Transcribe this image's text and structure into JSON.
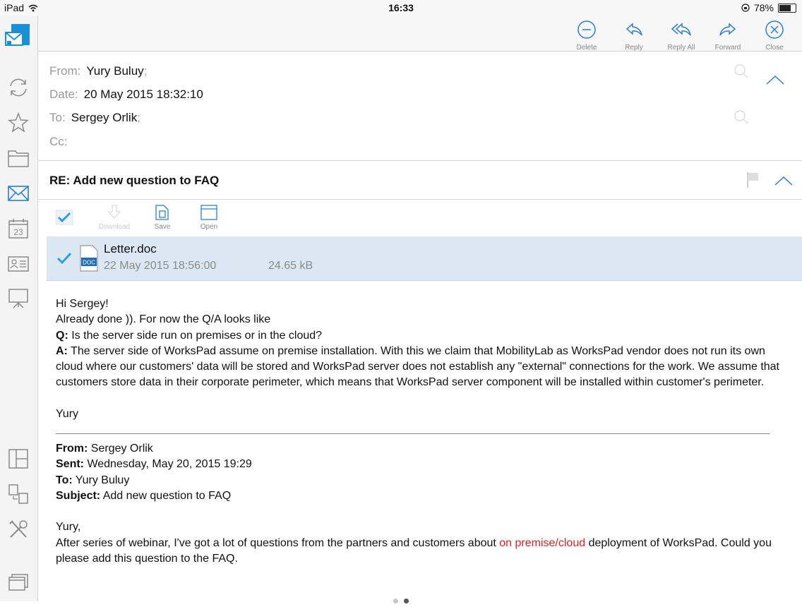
{
  "status": {
    "device": "iPad",
    "time": "16:33",
    "battery": "78%",
    "battery_level": 0.78
  },
  "sidebar": {
    "items": [
      "mail-app-icon",
      "sync-icon",
      "star-icon",
      "folder-icon",
      "mail-icon",
      "calendar-icon",
      "contacts-icon",
      "presentation-icon",
      "layout-icon",
      "devices-icon",
      "tools-icon",
      "windows-icon"
    ],
    "calendar_day": "23"
  },
  "toolbar": {
    "delete": "Delete",
    "reply": "Reply",
    "reply_all": "Reply All",
    "forward": "Forward",
    "close": "Close"
  },
  "accent_color": "#2b7fd1",
  "header": {
    "from_label": "From:",
    "from_value": "Yury Buluy",
    "date_label": "Date:",
    "date_value": "20 May 2015 18:32:10",
    "to_label": "To:",
    "to_value": "Sergey Orlik",
    "cc_label": "Cc:",
    "sep": ";"
  },
  "subject": "RE: Add new question to FAQ",
  "attachments_toolbar": {
    "download": "Download",
    "save": "Save",
    "open": "Open"
  },
  "attachment": {
    "icon_text": "DOC",
    "name": "Letter.doc",
    "date": "22 May 2015 18:56:00",
    "size": "24.65 kB"
  },
  "body": {
    "greeting": "Hi Sergey!",
    "line1": "Already done )). For now the Q/A looks like",
    "q_label": "Q:",
    "q_text": " Is the server side run on premises or in the cloud?",
    "a_label": "A:",
    "a_text": " The server side of WorksPad assume on premise installation. With this we claim that MobilityLab as WorksPad vendor does not run its own cloud where our customers' data will be stored and WorksPad server does not establish any \"external\" connections for the work. We assume that customers store data in their corporate perimeter, which means that WorksPad server component will be installed within customer's perimeter.",
    "signoff": "Yury",
    "quoted": {
      "from_label": "From:",
      "from_value": " Sergey Orlik",
      "sent_label": "Sent:",
      "sent_value": " Wednesday, May 20, 2015 19:29",
      "to_label": "To:",
      "to_value": " Yury Buluy",
      "subject_label": "Subject:",
      "subject_value": " Add new question to FAQ",
      "salutation": "Yury,",
      "text_before": "After series of webinar, I've got a lot of questions from the partners and customers about ",
      "highlight": "on premise/cloud",
      "text_after": " deployment of WorksPad. Could you please add this question to the FAQ."
    }
  },
  "pager": {
    "pages": 2,
    "current": 2
  }
}
